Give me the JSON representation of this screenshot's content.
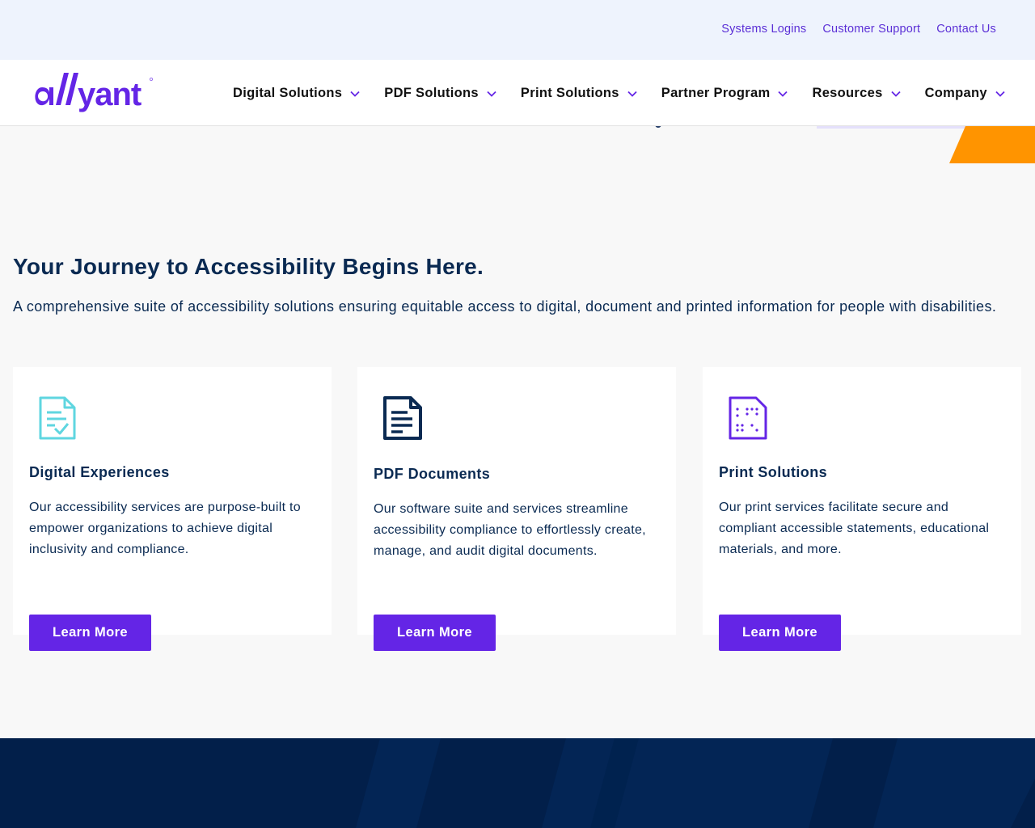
{
  "utility": {
    "links": [
      "Systems Logins",
      "Customer Support",
      "Contact Us"
    ]
  },
  "brand": {
    "logo_text": "allyant",
    "accent": "#6425e6",
    "orange": "#ff9400",
    "navy": "#0a2a52"
  },
  "nav": {
    "items": [
      "Digital Solutions",
      "PDF Solutions",
      "Print Solutions",
      "Partner Program",
      "Resources",
      "Company"
    ]
  },
  "hero": {
    "title": "Your Journey to Accessibility Begins Here.",
    "subtitle": "A comprehensive suite of accessibility solutions ensuring equitable access to digital, document and printed information for people with disabilities."
  },
  "cards": [
    {
      "icon": "document-check-icon",
      "title": "Digital Experiences",
      "text": "Our accessibility services are purpose-built to empower organizations to achieve digital inclusivity and compliance.",
      "button": "Learn More"
    },
    {
      "icon": "document-lines-icon",
      "title": "PDF Documents",
      "text": "Our software suite and services streamline accessibility compliance to effortlessly create, manage, and audit digital documents.",
      "button": "Learn More"
    },
    {
      "icon": "braille-document-icon",
      "title": "Print Solutions",
      "text": "Our print services facilitate secure and compliant accessible statements, educational materials, and more.",
      "button": "Learn More"
    }
  ]
}
